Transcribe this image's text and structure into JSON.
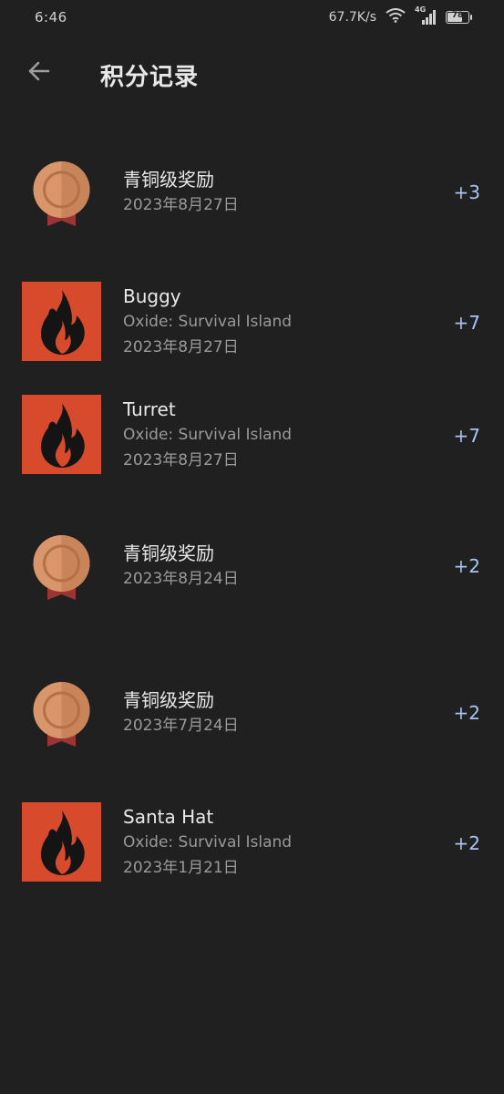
{
  "status_bar": {
    "time": "6:46",
    "net_speed": "67.7K/s",
    "network": "4G",
    "battery": "78",
    "battery_level": 0.78
  },
  "header": {
    "back_icon": "arrow-left-icon",
    "title": "积分记录"
  },
  "records": [
    {
      "type": "medal",
      "icon": "bronze-medal-icon",
      "title": "青铜级奖励",
      "game": "",
      "date": "2023年8月27日",
      "points": "+3"
    },
    {
      "type": "achievement",
      "icon": "fire-icon",
      "title": "Buggy",
      "game": "Oxide: Survival Island",
      "date": "2023年8月27日",
      "points": "+7"
    },
    {
      "type": "achievement",
      "icon": "fire-icon",
      "title": "Turret",
      "game": "Oxide: Survival Island",
      "date": "2023年8月27日",
      "points": "+7"
    },
    {
      "type": "medal",
      "icon": "bronze-medal-icon",
      "title": "青铜级奖励",
      "game": "",
      "date": "2023年8月24日",
      "points": "+2"
    },
    {
      "type": "medal",
      "icon": "bronze-medal-icon",
      "title": "青铜级奖励",
      "game": "",
      "date": "2023年7月24日",
      "points": "+2"
    },
    {
      "type": "achievement",
      "icon": "fire-icon",
      "title": "Santa Hat",
      "game": "Oxide: Survival Island",
      "date": "2023年1月21日",
      "points": "+2"
    }
  ],
  "colors": {
    "background": "#202020",
    "fire_tile": "#d84a2c",
    "points": "#a8c4f2",
    "bronze": "#d9966b"
  }
}
